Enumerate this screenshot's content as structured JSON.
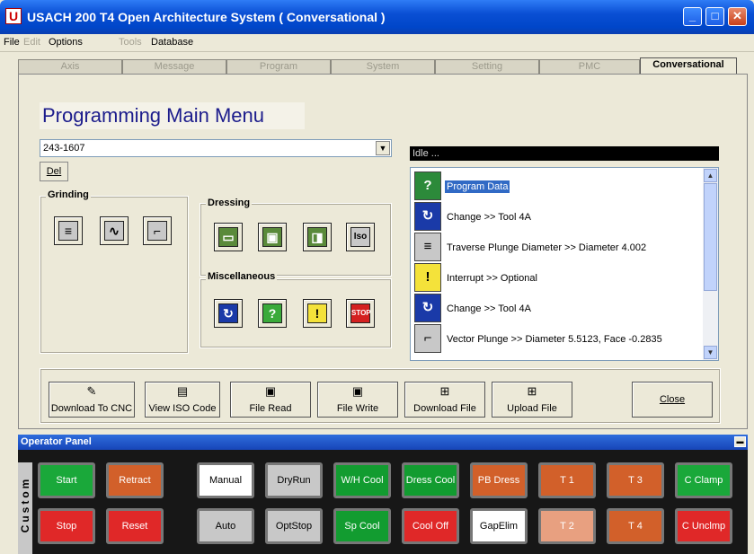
{
  "window": {
    "title": "USACH 200 T4 Open Architecture System  ( Conversational )",
    "icon": "U"
  },
  "menu": [
    {
      "label": "File",
      "disabled": false
    },
    {
      "label": "Edit",
      "disabled": true
    },
    {
      "label": "Options",
      "disabled": false
    },
    {
      "label": "Tools",
      "disabled": true
    },
    {
      "label": "Database",
      "disabled": false
    }
  ],
  "tabs": [
    "Axis",
    "Message",
    "Program",
    "System",
    "Setting",
    "PMC",
    "Conversational"
  ],
  "active_tab": "Conversational",
  "main": {
    "title": "Programming Main Menu",
    "combo_value": "243-1607",
    "del_label": "Del",
    "status": "Idle ..."
  },
  "groups": {
    "grinding": "Grinding",
    "dressing": "Dressing",
    "misc": "Miscellaneous"
  },
  "program_items": [
    {
      "icon": "question-icon",
      "text": "Program Data",
      "selected": true
    },
    {
      "icon": "tool-change-icon",
      "text": "Change >> Tool 4A",
      "selected": false
    },
    {
      "icon": "traverse-plunge-icon",
      "text": "Traverse Plunge Diameter >> Diameter 4.002",
      "selected": false
    },
    {
      "icon": "interrupt-warning-icon",
      "text": "Interrupt >> Optional",
      "selected": false
    },
    {
      "icon": "tool-change-icon",
      "text": "Change >> Tool 4A",
      "selected": false
    },
    {
      "icon": "vector-plunge-icon",
      "text": "Vector Plunge >> Diameter 5.5123, Face -0.2835",
      "selected": false
    }
  ],
  "buttons": {
    "download_cnc": "Download To CNC",
    "view_iso": "View ISO Code",
    "file_read": "File Read",
    "file_write": "File Write",
    "download_file": "Download File",
    "upload_file": "Upload File",
    "close": "Close"
  },
  "operator_panel": {
    "title": "Operator Panel",
    "side_label": "Custom",
    "row1": [
      {
        "label": "Start",
        "color": "#1aa83a"
      },
      {
        "label": "Retract",
        "color": "#d2602a"
      },
      {
        "label": "Manual",
        "color": "#ffffff"
      },
      {
        "label": "DryRun",
        "color": "#c8c8c8"
      },
      {
        "label": "W/H Cool",
        "color": "#129c30"
      },
      {
        "label": "Dress Cool",
        "color": "#129c30"
      },
      {
        "label": "PB Dress",
        "color": "#d2602a"
      },
      {
        "label": "T 1",
        "color": "#d2602a"
      },
      {
        "label": "T 3",
        "color": "#d2602a"
      },
      {
        "label": "C Clamp",
        "color": "#1aa83a"
      }
    ],
    "row2": [
      {
        "label": "Stop",
        "color": "#e02828"
      },
      {
        "label": "Reset",
        "color": "#e02828"
      },
      {
        "label": "Auto",
        "color": "#c8c8c8"
      },
      {
        "label": "OptStop",
        "color": "#c8c8c8"
      },
      {
        "label": "Sp Cool",
        "color": "#129c30"
      },
      {
        "label": "Cool Off",
        "color": "#e02828"
      },
      {
        "label": "GapElim",
        "color": "#ffffff"
      },
      {
        "label": "T 2",
        "color": "#e8a080"
      },
      {
        "label": "T 4",
        "color": "#d2602a"
      },
      {
        "label": "C Unclmp",
        "color": "#e02828"
      }
    ]
  }
}
